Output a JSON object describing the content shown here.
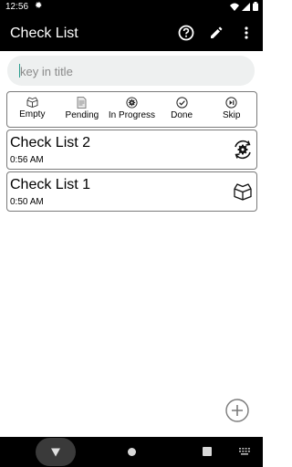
{
  "status_bar": {
    "time": "12:56"
  },
  "app_bar": {
    "title": "Check List"
  },
  "search": {
    "placeholder": "key in title",
    "value": ""
  },
  "filters": [
    {
      "label": "Empty",
      "icon": "empty-box-icon"
    },
    {
      "label": "Pending",
      "icon": "pending-document-icon"
    },
    {
      "label": "In Progress",
      "icon": "in-progress-gear-icon"
    },
    {
      "label": "Done",
      "icon": "done-check-icon"
    },
    {
      "label": "Skip",
      "icon": "skip-icon"
    }
  ],
  "items": [
    {
      "title": "Check List 2",
      "time": "0:56 AM",
      "status_icon": "in-progress-gear-icon"
    },
    {
      "title": "Check List 1",
      "time": "0:50 AM",
      "status_icon": "empty-box-icon"
    }
  ],
  "colors": {
    "app_bar": "#000000",
    "cursor": "#2a9d8f",
    "search_bg": "#eef0f0",
    "border": "#7a7a7a"
  }
}
